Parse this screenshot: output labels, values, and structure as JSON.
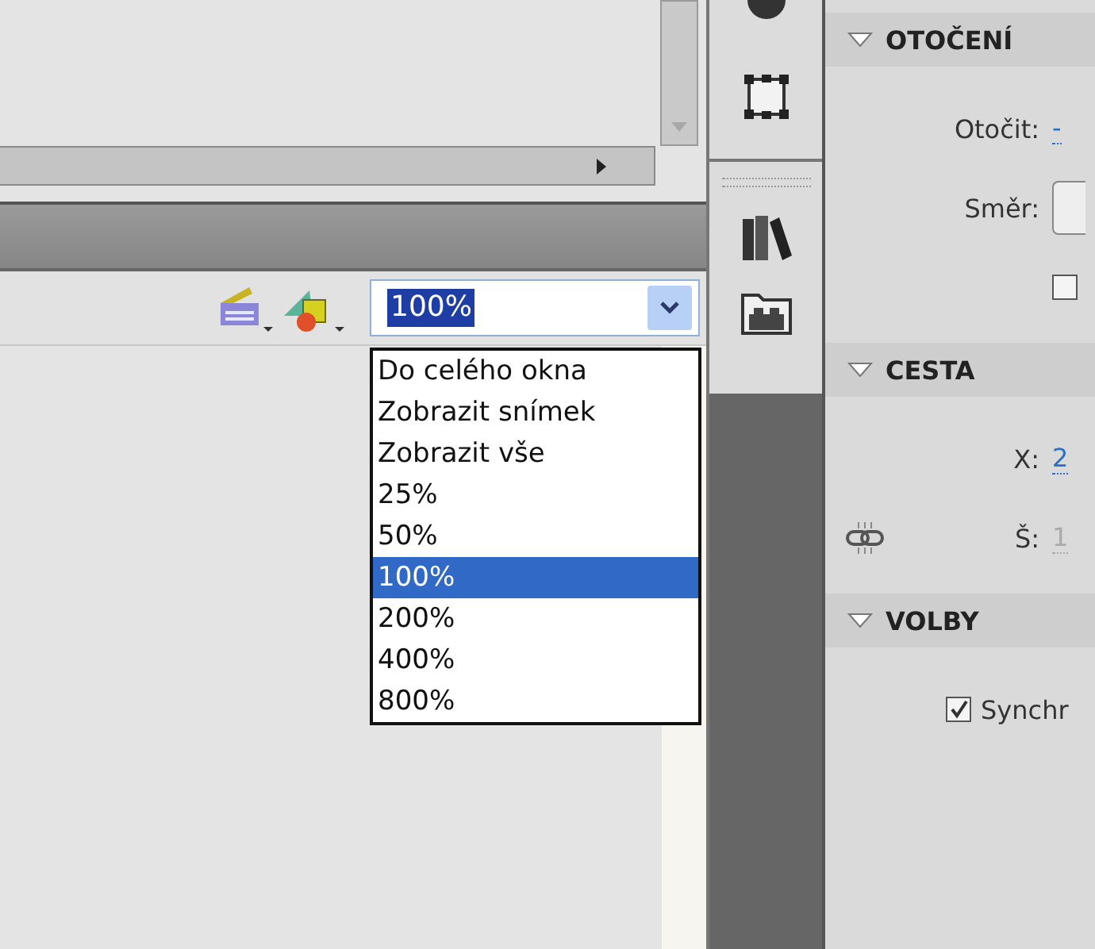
{
  "zoom": {
    "value": "100%",
    "options": [
      {
        "label": "Do celého okna",
        "selected": false
      },
      {
        "label": "Zobrazit snímek",
        "selected": false
      },
      {
        "label": "Zobrazit vše",
        "selected": false
      },
      {
        "label": "25%",
        "selected": false
      },
      {
        "label": "50%",
        "selected": false
      },
      {
        "label": "100%",
        "selected": true
      },
      {
        "label": "200%",
        "selected": false
      },
      {
        "label": "400%",
        "selected": false
      },
      {
        "label": "800%",
        "selected": false
      }
    ]
  },
  "sections": [
    {
      "title": "OTOČENÍ",
      "expanded": true,
      "rows": [
        {
          "kind": "field",
          "label": "Otočit:",
          "value": "-"
        },
        {
          "kind": "select",
          "label": "Směr:"
        },
        {
          "kind": "checkbox",
          "checked": false
        }
      ]
    },
    {
      "title": "CESTA",
      "expanded": true,
      "rows": [
        {
          "kind": "field",
          "label": "X:",
          "value": "2"
        },
        {
          "kind": "field",
          "label": "Š:",
          "value": "1",
          "disabled": true,
          "link": true
        }
      ]
    },
    {
      "title": "VOLBY",
      "expanded": true,
      "rows": [
        {
          "kind": "checkbox",
          "checked": true,
          "label": "Synchr"
        }
      ]
    }
  ]
}
